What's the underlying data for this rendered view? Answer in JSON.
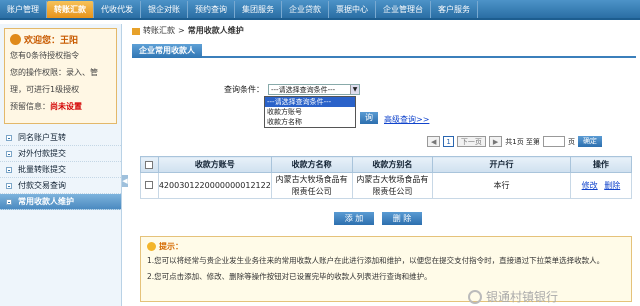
{
  "nav": {
    "tabs": [
      {
        "label": "账户管理"
      },
      {
        "label": "转账汇款",
        "active": true
      },
      {
        "label": "代收代发"
      },
      {
        "label": "银企对账"
      },
      {
        "label": "预约查询"
      },
      {
        "label": "集团服务"
      },
      {
        "label": "企业贷款"
      },
      {
        "label": "票据中心"
      },
      {
        "label": "企业管理台"
      },
      {
        "label": "客户服务"
      }
    ]
  },
  "welcome": {
    "hello": "欢迎您：王阳",
    "line1": "您有0条待授权指令",
    "line2": "您的操作权限：录入、管",
    "line3": "理，可进行1级授权",
    "line4_label": "预留信息：",
    "line4_value": "尚未设置"
  },
  "menu": {
    "items": [
      {
        "label": "同名账户互转"
      },
      {
        "label": "对外付款提交"
      },
      {
        "label": "批量转账提交"
      },
      {
        "label": "付款交易查询"
      },
      {
        "label": "常用收款人维护",
        "active": true
      }
    ]
  },
  "breadcrumb": {
    "part1": "转账汇款",
    "sep": ">",
    "part2": "常用收款人维护"
  },
  "panel": {
    "title": "企业常用收款人"
  },
  "query": {
    "label": "查询条件：",
    "selected": "---请选择查询条件---",
    "options": [
      "---请选择查询条件---",
      "收款方账号",
      "收款方名称"
    ],
    "button": "询",
    "advanced": "高级查询>>"
  },
  "pager": {
    "first": "◀",
    "current": "1",
    "prev": "下一页",
    "next": "▶",
    "total": "共1页 至第",
    "page_suffix": "页",
    "go": "确定"
  },
  "table": {
    "headers": [
      "",
      "收款方账号",
      "收款方名称",
      "收款方别名",
      "开户行",
      "操作"
    ],
    "rows": [
      {
        "account": "4200301220000000012122",
        "name": "内蒙古大牧场食品有限责任公司",
        "alias": "内蒙古大牧场食品有限责任公司",
        "bank": "本行",
        "edit": "修改",
        "del": "删除"
      }
    ]
  },
  "actions": {
    "add": "添 加",
    "del": "删 除"
  },
  "tips": {
    "title": "提示：",
    "line1": "1.您可以将经常与贵企业发生业务往来的常用收款人账户在此进行添加和维护，以便您在提交支付指令时，直接通过下拉菜单选择收款人。",
    "line2": "2.您可点击添加、修改、删除等操作按钮对已设置完毕的收款人列表进行查询和维护。"
  },
  "watermark": {
    "text": "银通村镇银行"
  }
}
